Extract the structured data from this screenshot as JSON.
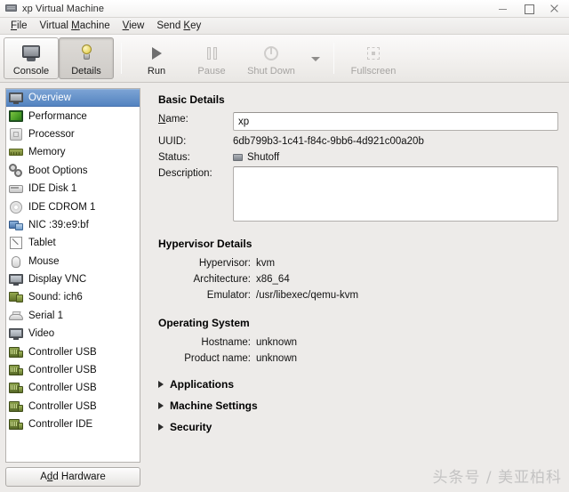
{
  "window": {
    "title": "xp Virtual Machine",
    "icon": "vm-monitor-icon",
    "minimize": "–",
    "maximize": "□",
    "close": "✕"
  },
  "menubar": {
    "items": [
      {
        "label": "File",
        "mnemonic": "F"
      },
      {
        "label": "Virtual Machine",
        "mnemonic": "M"
      },
      {
        "label": "View",
        "mnemonic": "V"
      },
      {
        "label": "Send Key",
        "mnemonic": "K"
      }
    ]
  },
  "toolbar": {
    "buttons": [
      {
        "label": "Console",
        "icon": "monitor-icon",
        "state": "normal"
      },
      {
        "label": "Details",
        "icon": "lightbulb-icon",
        "state": "active"
      },
      {
        "label": "Run",
        "icon": "play-icon",
        "state": "enabled"
      },
      {
        "label": "Pause",
        "icon": "pause-icon",
        "state": "disabled"
      },
      {
        "label": "Shut Down",
        "icon": "power-icon",
        "state": "disabled"
      },
      {
        "label": "",
        "icon": "chevron-down-icon",
        "state": "disabled"
      },
      {
        "label": "Fullscreen",
        "icon": "fullscreen-icon",
        "state": "disabled"
      }
    ]
  },
  "sidebar": {
    "add_hardware_label": "Add Hardware",
    "add_hardware_mnemonic": "d",
    "items": [
      {
        "label": "Overview",
        "icon": "screen-icon",
        "selected": true
      },
      {
        "label": "Performance",
        "icon": "performance-icon",
        "selected": false
      },
      {
        "label": "Processor",
        "icon": "cpu-icon",
        "selected": false
      },
      {
        "label": "Memory",
        "icon": "memory-icon",
        "selected": false
      },
      {
        "label": "Boot Options",
        "icon": "gears-icon",
        "selected": false
      },
      {
        "label": "IDE Disk 1",
        "icon": "harddisk-icon",
        "selected": false
      },
      {
        "label": "IDE CDROM 1",
        "icon": "cdrom-icon",
        "selected": false
      },
      {
        "label": "NIC :39:e9:bf",
        "icon": "network-icon",
        "selected": false
      },
      {
        "label": "Tablet",
        "icon": "tablet-icon",
        "selected": false
      },
      {
        "label": "Mouse",
        "icon": "mouse-icon",
        "selected": false
      },
      {
        "label": "Display VNC",
        "icon": "display-icon",
        "selected": false
      },
      {
        "label": "Sound: ich6",
        "icon": "sound-icon",
        "selected": false
      },
      {
        "label": "Serial 1",
        "icon": "serial-icon",
        "selected": false
      },
      {
        "label": "Video",
        "icon": "video-icon",
        "selected": false
      },
      {
        "label": "Controller USB",
        "icon": "usb-icon",
        "selected": false
      },
      {
        "label": "Controller USB",
        "icon": "usb-icon",
        "selected": false
      },
      {
        "label": "Controller USB",
        "icon": "usb-icon",
        "selected": false
      },
      {
        "label": "Controller USB",
        "icon": "usb-icon",
        "selected": false
      },
      {
        "label": "Controller IDE",
        "icon": "ide-icon",
        "selected": false
      }
    ]
  },
  "details": {
    "basic": {
      "title": "Basic Details",
      "name_label": "Name:",
      "name_value": "xp",
      "uuid_label": "UUID:",
      "uuid_value": "6db799b3-1c41-f84c-9bb6-4d921c00a20b",
      "status_label": "Status:",
      "status_value": "Shutoff",
      "status_icon": "shutoff-monitor-icon",
      "description_label": "Description:",
      "description_value": ""
    },
    "hypervisor": {
      "title": "Hypervisor Details",
      "rows": [
        {
          "label": "Hypervisor:",
          "value": "kvm"
        },
        {
          "label": "Architecture:",
          "value": "x86_64"
        },
        {
          "label": "Emulator:",
          "value": "/usr/libexec/qemu-kvm"
        }
      ]
    },
    "operating_system": {
      "title": "Operating System",
      "rows": [
        {
          "label": "Hostname:",
          "value": "unknown"
        },
        {
          "label": "Product name:",
          "value": "unknown"
        }
      ]
    },
    "expanders": [
      {
        "label": "Applications",
        "expanded": false
      },
      {
        "label": "Machine Settings",
        "expanded": false
      },
      {
        "label": "Security",
        "expanded": false
      }
    ]
  },
  "watermark": {
    "text": "头条号 / 美亚柏科"
  },
  "colors": {
    "selection_blue": "#5383c0",
    "window_bg": "#edebe9",
    "list_bg": "#ffffff",
    "border": "#b6b3b0"
  }
}
